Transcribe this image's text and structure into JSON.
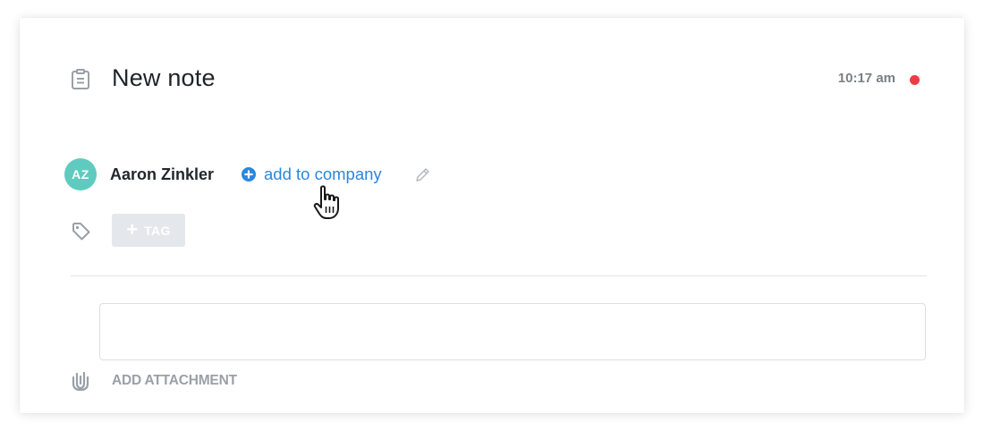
{
  "note": {
    "icon": "clipboard-note-icon",
    "title": "New note",
    "time": "10:17 am",
    "status_color": "#ef3a48"
  },
  "contact": {
    "avatar_initials": "AZ",
    "avatar_color": "#5fcbc0",
    "name": "Aaron Zinkler",
    "add_to_company_icon": "plus-circle-icon",
    "add_to_company_label": "add to company",
    "edit_icon": "pencil-icon",
    "link_color": "#2a86e0"
  },
  "tags": {
    "icon": "tag-icon",
    "add_icon": "+",
    "add_label": "TAG"
  },
  "body": {
    "value": "",
    "placeholder": ""
  },
  "attachment": {
    "icon": "paperclip-icon",
    "label": "ADD ATTACHMENT"
  },
  "cursor": {
    "icon": "hand-pointer-cursor-icon"
  }
}
